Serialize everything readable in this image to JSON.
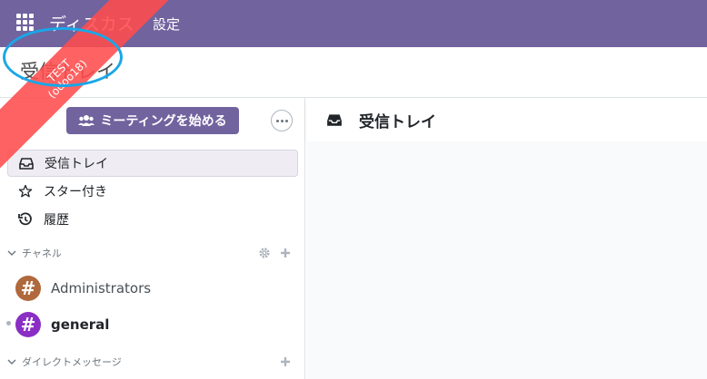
{
  "topbar": {
    "app_name": "ディスカス",
    "menu_settings": "設定"
  },
  "control_panel": {
    "title": "受信トレイ"
  },
  "sidebar": {
    "meeting_button": "ミーティングを始める",
    "nav": [
      {
        "label": "受信トレイ",
        "icon": "inbox-icon",
        "active": true
      },
      {
        "label": "スター付き",
        "icon": "star-icon"
      },
      {
        "label": "履歴",
        "icon": "history-icon"
      }
    ],
    "channels_header": "チャネル",
    "channels": [
      {
        "name": "Administrators",
        "color": "#b0693c"
      },
      {
        "name": "general",
        "color": "#8a2ec4",
        "unread": true
      }
    ],
    "direct_messages_header": "ダイレクトメッセージ"
  },
  "thread": {
    "title": "受信トレイ"
  },
  "ribbon": {
    "line1": "TEST",
    "line2": "(odoo18)"
  },
  "colors": {
    "brand": "#71639e",
    "ribbon": "#ff4c4c",
    "highlight": "#19a7e8"
  }
}
